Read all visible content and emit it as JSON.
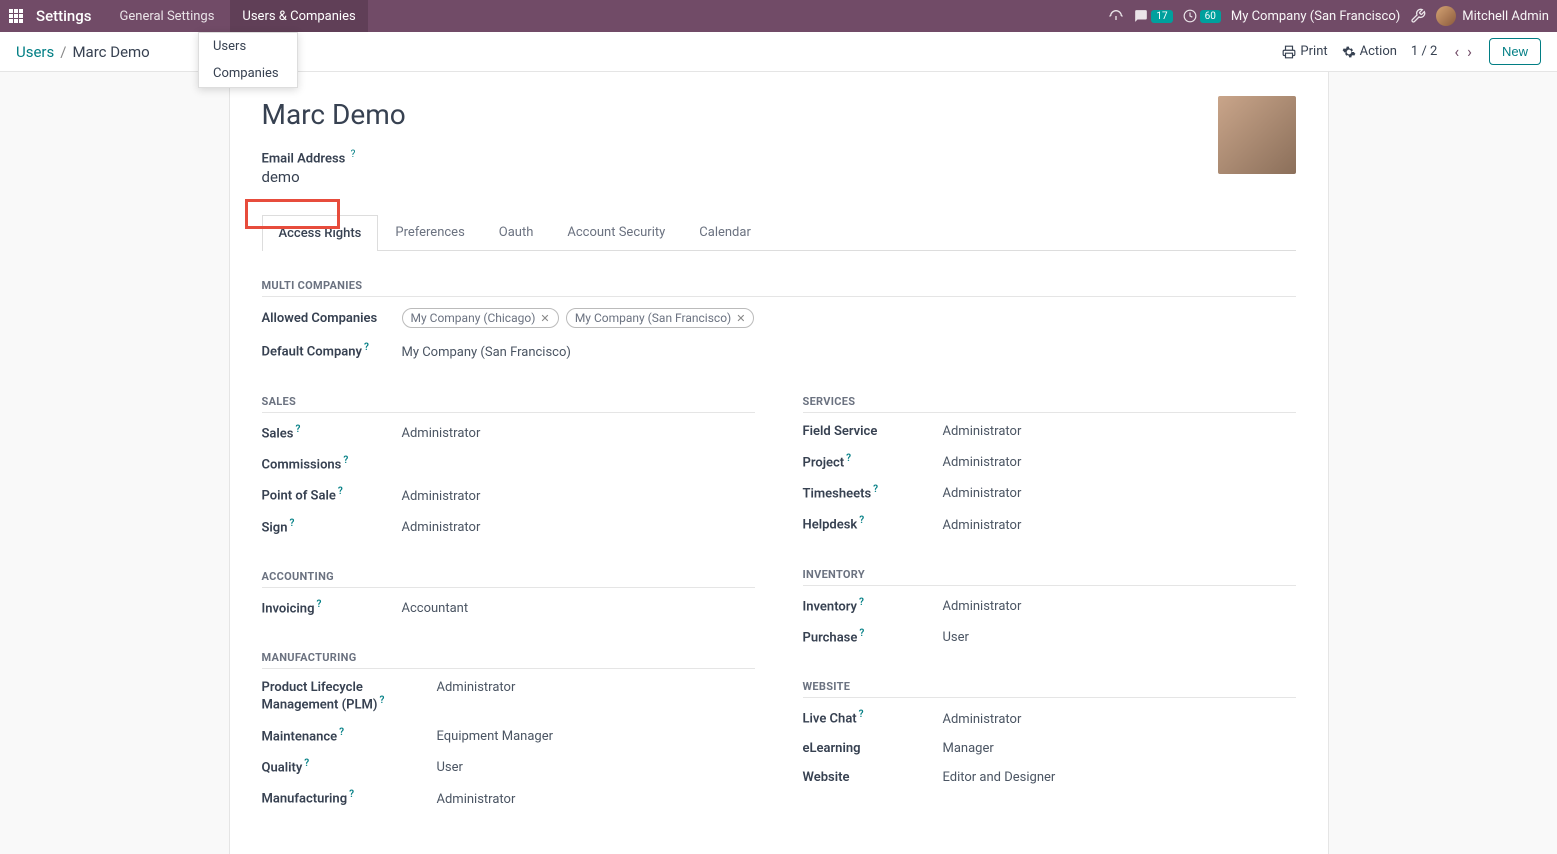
{
  "navbar": {
    "title": "Settings",
    "links": [
      {
        "label": "General Settings"
      },
      {
        "label": "Users & Companies"
      }
    ],
    "messages_count": "17",
    "activities_count": "60",
    "company": "My Company (San Francisco)",
    "user_name": "Mitchell Admin"
  },
  "dropdown": {
    "item_users": "Users",
    "item_companies": "Companies"
  },
  "breadcrumb": {
    "root": "Users",
    "current": "Marc Demo"
  },
  "actions": {
    "print": "Print",
    "action": "Action",
    "pager": "1 / 2",
    "new": "New"
  },
  "form": {
    "name": "Marc Demo",
    "email_label": "Email Address",
    "email_value": "demo"
  },
  "tabs": {
    "access_rights": "Access Rights",
    "preferences": "Preferences",
    "oauth": "Oauth",
    "account_security": "Account Security",
    "calendar": "Calendar"
  },
  "sections": {
    "multi_companies": {
      "title": "MULTI COMPANIES",
      "allowed_label": "Allowed Companies",
      "default_label": "Default Company",
      "default_value": "My Company (San Francisco)",
      "tags": [
        {
          "label": "My Company (Chicago)"
        },
        {
          "label": "My Company (San Francisco)"
        }
      ]
    },
    "sales": {
      "title": "SALES",
      "rows": [
        {
          "label": "Sales",
          "value": "Administrator",
          "help": true
        },
        {
          "label": "Commissions",
          "value": "",
          "help": true
        },
        {
          "label": "Point of Sale",
          "value": "Administrator",
          "help": true
        },
        {
          "label": "Sign",
          "value": "Administrator",
          "help": true
        }
      ]
    },
    "services": {
      "title": "SERVICES",
      "rows": [
        {
          "label": "Field Service",
          "value": "Administrator",
          "help": false
        },
        {
          "label": "Project",
          "value": "Administrator",
          "help": true
        },
        {
          "label": "Timesheets",
          "value": "Administrator",
          "help": true
        },
        {
          "label": "Helpdesk",
          "value": "Administrator",
          "help": true
        }
      ]
    },
    "accounting": {
      "title": "ACCOUNTING",
      "rows": [
        {
          "label": "Invoicing",
          "value": "Accountant",
          "help": true
        }
      ]
    },
    "inventory": {
      "title": "INVENTORY",
      "rows": [
        {
          "label": "Inventory",
          "value": "Administrator",
          "help": true
        },
        {
          "label": "Purchase",
          "value": "User",
          "help": true
        }
      ]
    },
    "manufacturing": {
      "title": "MANUFACTURING",
      "rows": [
        {
          "label": "Product Lifecycle Management (PLM)",
          "value": "Administrator",
          "help": true
        },
        {
          "label": "Maintenance",
          "value": "Equipment Manager",
          "help": true
        },
        {
          "label": "Quality",
          "value": "User",
          "help": true
        },
        {
          "label": "Manufacturing",
          "value": "Administrator",
          "help": true
        }
      ]
    },
    "website": {
      "title": "WEBSITE",
      "rows": [
        {
          "label": "Live Chat",
          "value": "Administrator",
          "help": true
        },
        {
          "label": "eLearning",
          "value": "Manager",
          "help": false
        },
        {
          "label": "Website",
          "value": "Editor and Designer",
          "help": false
        }
      ]
    }
  }
}
